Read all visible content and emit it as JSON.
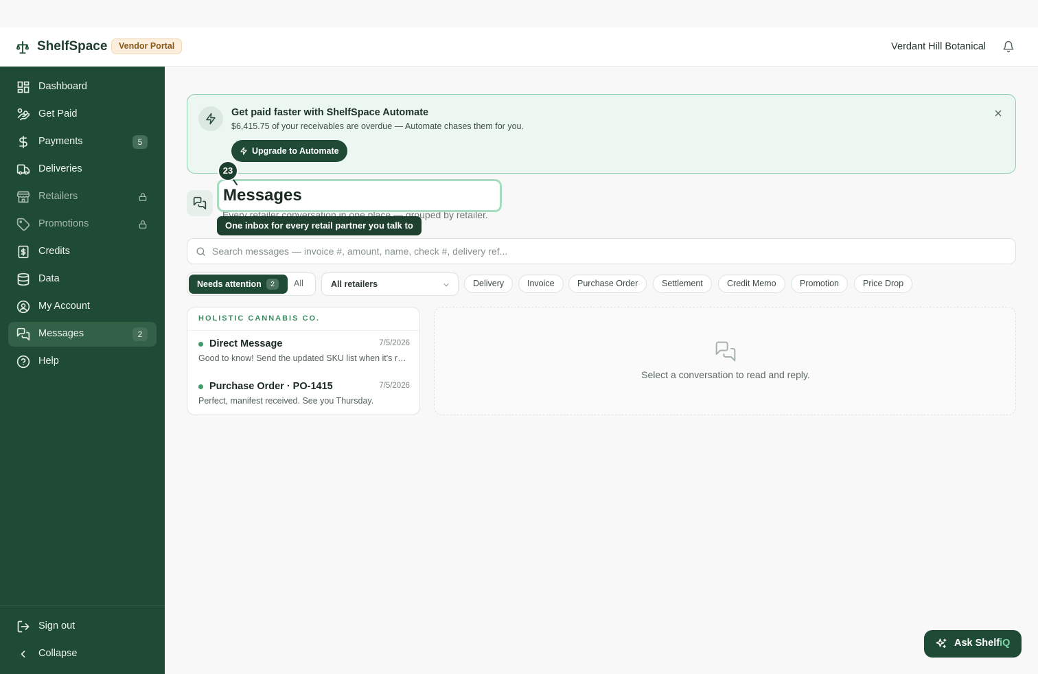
{
  "header": {
    "brand": "ShelfSpace",
    "badge": "Vendor Portal",
    "org_name": "Verdant Hill Botanical"
  },
  "sidebar": {
    "items": [
      {
        "label": "Dashboard",
        "icon": "grid-icon"
      },
      {
        "label": "Get Paid",
        "icon": "hand-coins-icon"
      },
      {
        "label": "Payments",
        "icon": "dollar-icon",
        "badge": "5"
      },
      {
        "label": "Deliveries",
        "icon": "truck-icon"
      },
      {
        "label": "Retailers",
        "icon": "store-icon",
        "locked": true
      },
      {
        "label": "Promotions",
        "icon": "tag-icon",
        "locked": true
      },
      {
        "label": "Credits",
        "icon": "receipt-dollar-icon"
      },
      {
        "label": "Data",
        "icon": "database-icon"
      },
      {
        "label": "My Account",
        "icon": "user-circle-icon"
      },
      {
        "label": "Messages",
        "icon": "messages-icon",
        "badge": "2",
        "active": true
      },
      {
        "label": "Help",
        "icon": "help-circle-icon"
      }
    ],
    "sign_out": "Sign out",
    "collapse": "Collapse"
  },
  "promo": {
    "title": "Get paid faster with ShelfSpace Automate",
    "subtitle": "$6,415.75 of your receivables are overdue — Automate chases them for you.",
    "button": "Upgrade to Automate"
  },
  "page": {
    "title": "Messages",
    "subtitle": "Every retailer conversation in one place — grouped by retailer.",
    "step_number": "23",
    "tooltip": "One inbox for every retail partner you talk to"
  },
  "search": {
    "placeholder": "Search messages — invoice #, amount, name, check #, delivery ref..."
  },
  "filters": {
    "needs_attention": "Needs attention",
    "needs_attention_count": "2",
    "all": "All",
    "retailer_select": "All retailers",
    "chips": [
      "Delivery",
      "Invoice",
      "Purchase Order",
      "Settlement",
      "Credit Memo",
      "Promotion",
      "Price Drop"
    ]
  },
  "conversations": {
    "group": "HOLISTIC CANNABIS CO.",
    "items": [
      {
        "title": "Direct Message",
        "date": "7/5/2026",
        "preview": "Good to know! Send the updated SKU list when it's ready."
      },
      {
        "title": "Purchase Order · PO-1415",
        "date": "7/5/2026",
        "preview": "Perfect, manifest received. See you Thursday."
      }
    ]
  },
  "detail": {
    "empty_text": "Select a conversation to read and reply."
  },
  "assistant": {
    "label_main": "Ask Shelf",
    "label_accent": "iQ"
  },
  "colors": {
    "sidebar_bg": "#1f4a35",
    "accent_green": "#3c9a68",
    "promo_bg": "#ecf7f1",
    "badge_bg": "#fbeedd"
  }
}
